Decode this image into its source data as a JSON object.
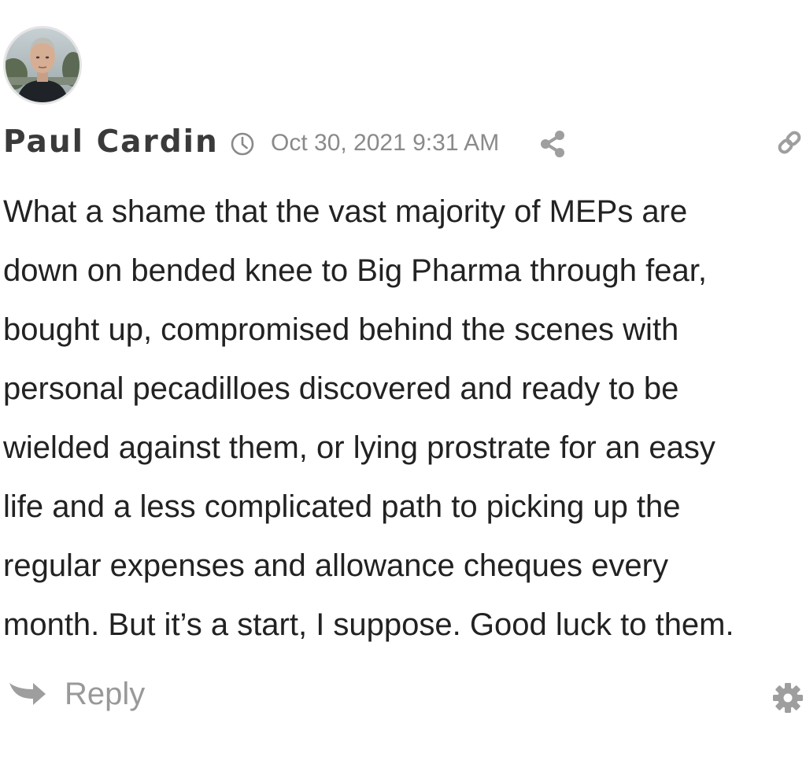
{
  "comment": {
    "author": "Paul Cardin",
    "timestamp": "Oct 30, 2021 9:31 AM",
    "body_lines": [
      "What a shame that the vast majority of MEPs are",
      "down on bended knee to Big Pharma through fear,",
      "bought up, compromised behind the scenes with",
      "personal pecadilloes discovered and ready to be",
      "wielded against them, or lying prostrate for an easy",
      "life and a less complicated path to picking up the",
      "regular expenses and allowance cheques every",
      "month. But it’s a start, I suppose. Good luck to them."
    ],
    "reply_label": "Reply",
    "icons": {
      "clock": "clock-icon",
      "share": "share-icon",
      "link": "link-icon",
      "reply": "reply-arrow-icon",
      "settings": "gear-icon"
    }
  },
  "colors": {
    "author": "#3a3a3a",
    "meta": "#8a8a8a",
    "body": "#222222",
    "muted_icon": "#9e9e9e"
  }
}
